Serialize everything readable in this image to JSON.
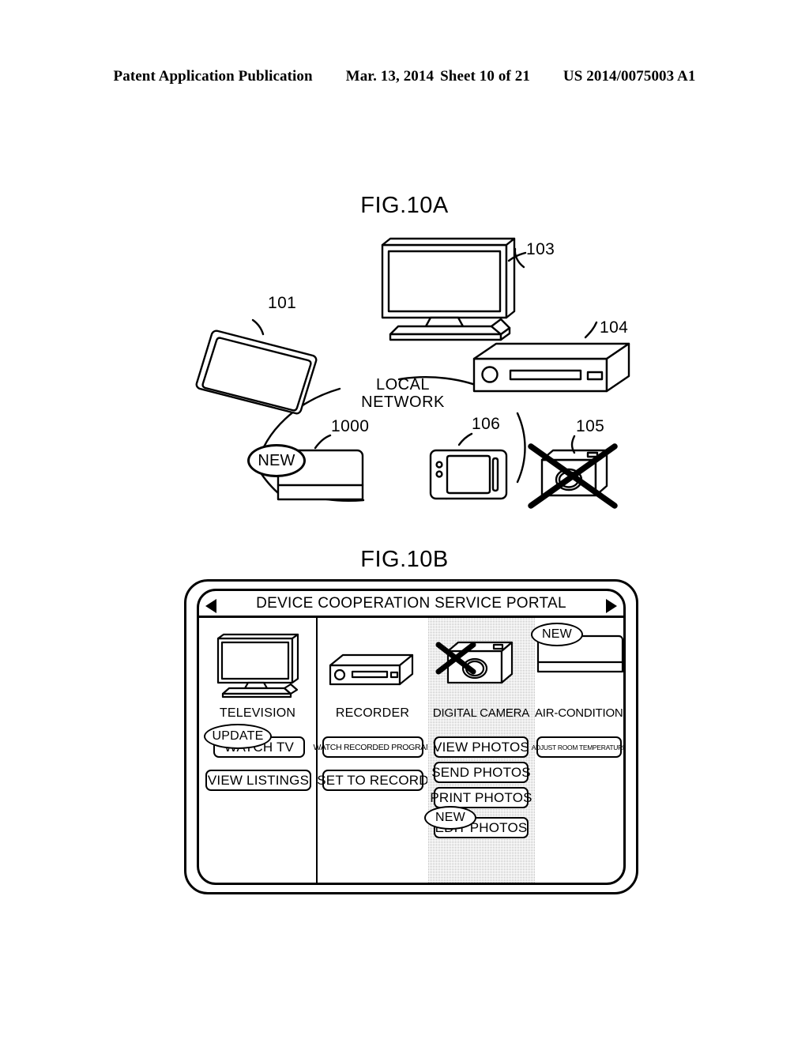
{
  "header": {
    "publication": "Patent Application Publication",
    "date": "Mar. 13, 2014",
    "sheet": "Sheet 10 of 21",
    "docnum": "US 2014/0075003 A1"
  },
  "figures": {
    "a": {
      "caption": "FIG.10A",
      "network_label_line1": "LOCAL",
      "network_label_line2": "NETWORK",
      "new_badge": "NEW",
      "devices": [
        {
          "ref": "101",
          "name": "tablet"
        },
        {
          "ref": "103",
          "name": "television"
        },
        {
          "ref": "104",
          "name": "recorder"
        },
        {
          "ref": "105",
          "name": "digital-camera-disabled"
        },
        {
          "ref": "106",
          "name": "smartphone"
        },
        {
          "ref": "1000",
          "name": "new-device"
        }
      ]
    },
    "b": {
      "caption": "FIG.10B",
      "portal_title": "DEVICE COOPERATION SERVICE PORTAL",
      "nav_prev_icon": "triangle-left-icon",
      "nav_next_icon": "triangle-right-icon",
      "columns": [
        {
          "device": "TELEVISION",
          "icon": "television-icon",
          "highlight": false,
          "disabled": false,
          "badge": "UPDATE",
          "badge_target": "WATCH TV",
          "buttons": [
            "WATCH TV",
            "VIEW LISTINGS"
          ]
        },
        {
          "device": "RECORDER",
          "icon": "recorder-icon",
          "highlight": false,
          "disabled": false,
          "badge": null,
          "badge_target": null,
          "buttons": [
            "WATCH RECORDED PROGRAM",
            "SET TO RECORD"
          ]
        },
        {
          "device": "DIGITAL CAMERA",
          "icon": "digital-camera-icon",
          "highlight": true,
          "disabled": true,
          "badge": "NEW",
          "badge_target": "EDIT PHOTOS",
          "buttons": [
            "VIEW PHOTOS",
            "SEND PHOTOS",
            "PRINT PHOTOS",
            "EDIT PHOTOS"
          ]
        },
        {
          "device": "AIR-CONDITIONER",
          "icon": "air-conditioner-icon",
          "highlight": false,
          "disabled": false,
          "badge": "NEW",
          "badge_target": "air-conditioner-icon",
          "buttons": [
            "ADJUST ROOM TEMPERATURE"
          ]
        }
      ]
    }
  },
  "colors": {
    "ink": "#000000",
    "paper": "#ffffff",
    "highlight": "#b9b9b9"
  }
}
